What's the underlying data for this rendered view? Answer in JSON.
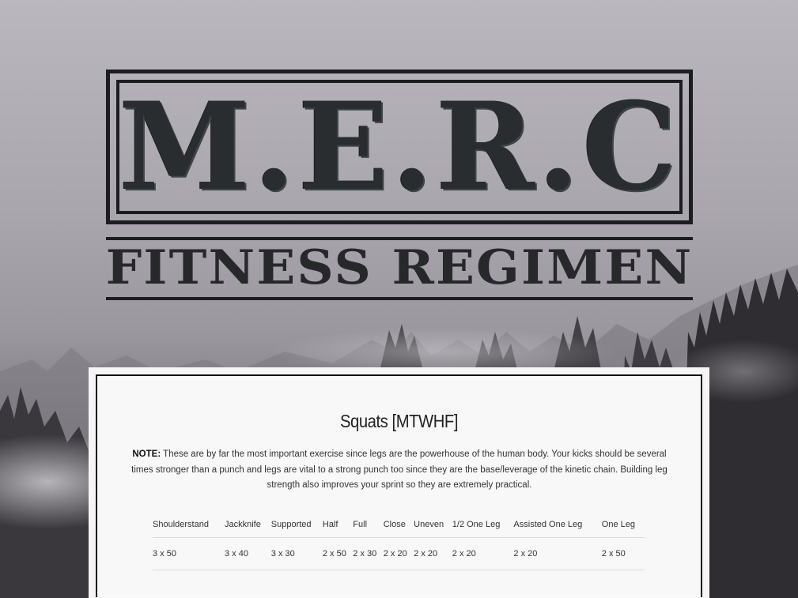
{
  "logo": {
    "title": "M.E.R.C",
    "subtitle": "FITNESS REGIMEN"
  },
  "section": {
    "title": "Squats [MTWHF]",
    "note_label": "NOTE:",
    "note_text": " These are by far the most important exercise since legs are the powerhouse of the human body. Your kicks should be several times stronger than a punch and legs are vital to a strong punch too since they are the base/leverage of the kinetic chain. Building leg strength also improves your sprint so they are extremely practical."
  },
  "table": {
    "headers": [
      "Shoulderstand",
      "Jackknife",
      "Supported",
      "Half",
      "Full",
      "Close",
      "Uneven",
      "1/2 One Leg",
      "Assisted One Leg",
      "One Leg"
    ],
    "rows": [
      [
        "3 x 50",
        "3 x 40",
        "3 x 30",
        "2 x 50",
        "2 x 30",
        "2 x 20",
        "2 x 20",
        "2 x 20",
        "2 x 20",
        "2 x 50"
      ]
    ]
  },
  "colors": {
    "logo_ink": "#1c1d1f",
    "card_background": "#f8f8f8",
    "card_border": "#111111",
    "background_sky": "#b3b0b8",
    "background_trees": "#2f2d32"
  }
}
